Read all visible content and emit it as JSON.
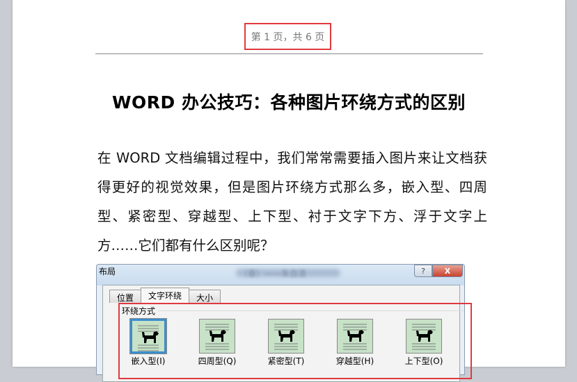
{
  "header": {
    "page_info": "第 1 页，共 6 页"
  },
  "title": {
    "prefix": "WORD",
    "rest": " 办公技巧：各种图片环绕方式的区别"
  },
  "body": "在 WORD 文档编辑过程中，我们常常需要插入图片来让文档获得更好的视觉效果，但是图片环绕方式那么多，嵌入型、四周型、紧密型、穿越型、上下型、衬于文字下方、浮于文字上方……它们都有什么区别呢？",
  "dialog": {
    "title": "布局",
    "blurred_caption": "（春）——朱自清",
    "help": "?",
    "close": "X",
    "tabs": [
      "位置",
      "文字环绕",
      "大小"
    ],
    "group": "环绕方式",
    "options": [
      "嵌入型(I)",
      "四周型(Q)",
      "紧密型(T)",
      "穿越型(H)",
      "上下型(O)"
    ]
  }
}
